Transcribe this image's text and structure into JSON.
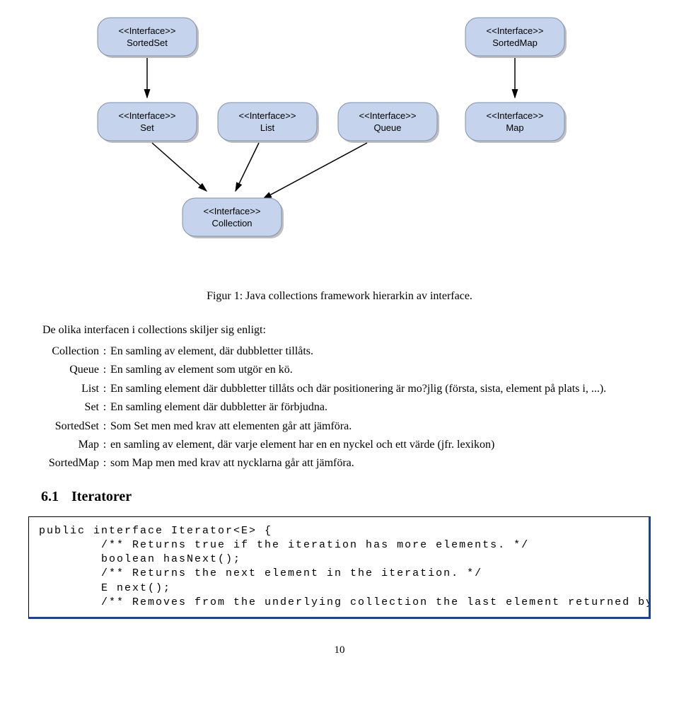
{
  "diagram": {
    "nodes": {
      "sortedSet": {
        "line1": "<<Interface>>",
        "line2": "SortedSet"
      },
      "sortedMap": {
        "line1": "<<Interface>>",
        "line2": "SortedMap"
      },
      "set": {
        "line1": "<<Interface>>",
        "line2": "Set"
      },
      "list": {
        "line1": "<<Interface>>",
        "line2": "List"
      },
      "queue": {
        "line1": "<<Interface>>",
        "line2": "Queue"
      },
      "map": {
        "line1": "<<Interface>>",
        "line2": "Map"
      },
      "collection": {
        "line1": "<<Interface>>",
        "line2": "Collection"
      }
    }
  },
  "figCaption": "Figur 1: Java collections framework hierarkin av interface.",
  "intro": "De olika interfacen i collections skiljer sig enligt:",
  "defs": [
    {
      "term": "Collection",
      "desc": "En samling av element, där dubbletter tillåts."
    },
    {
      "term": "Queue",
      "desc": "En samling av element som utgör en kö."
    },
    {
      "term": "List",
      "desc": "En samling element där dubbletter tillåts och där positionering är mo?jlig (första, sista, element på plats i, ...)."
    },
    {
      "term": "Set",
      "desc": "En samling element där dubbletter är förbjudna."
    },
    {
      "term": "SortedSet",
      "desc": "Som Set men med krav att elementen går att jämföra."
    },
    {
      "term": "Map",
      "desc": "en samling av element, där varje element har en en nyckel och ett värde (jfr. lexikon)"
    },
    {
      "term": "SortedMap",
      "desc": "som Map men med krav att nycklarna går att jämföra."
    }
  ],
  "section": {
    "num": "6.1",
    "title": "Iteratorer"
  },
  "code": "public interface Iterator<E> {\n        /** Returns true if the iteration has more elements. */\n        boolean hasNext();\n        /** Returns the next element in the iteration. */\n        E next();\n        /** Removes from the underlying collection the last element returned by the iter",
  "pageNum": "10"
}
